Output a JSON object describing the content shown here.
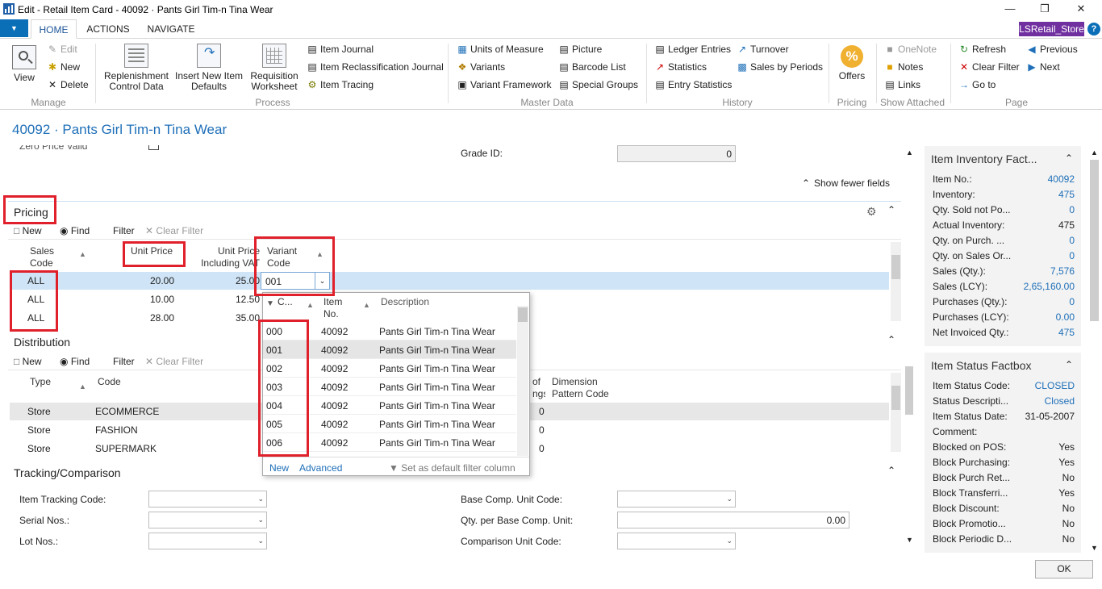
{
  "window": {
    "title": "Edit - Retail Item Card - 40092 · Pants Girl Tim-n Tina Wear"
  },
  "ribbon": {
    "tabs": [
      "HOME",
      "ACTIONS",
      "NAVIGATE"
    ],
    "company": "LSRetail_Store",
    "manage": {
      "view": "View",
      "edit": "Edit",
      "new": "New",
      "delete": "Delete",
      "group": "Manage"
    },
    "process": {
      "replenishment": "Replenishment Control Data",
      "insert_defaults": "Insert New Item Defaults",
      "requisition": "Requisition Worksheet",
      "item_journal": "Item Journal",
      "item_reclass": "Item Reclassification Journal",
      "item_tracing": "Item Tracing",
      "group": "Process"
    },
    "master": {
      "uom": "Units of Measure",
      "variants": "Variants",
      "variant_framework": "Variant Framework",
      "picture": "Picture",
      "barcode": "Barcode List",
      "special_groups": "Special Groups",
      "group": "Master Data"
    },
    "history": {
      "ledger": "Ledger Entries",
      "statistics": "Statistics",
      "entry_stats": "Entry Statistics",
      "turnover": "Turnover",
      "sales_periods": "Sales by Periods",
      "group": "History"
    },
    "pricing": {
      "offers": "Offers",
      "group": "Pricing"
    },
    "show_attached": {
      "onenote": "OneNote",
      "notes": "Notes",
      "links": "Links",
      "group": "Show Attached"
    },
    "page": {
      "refresh": "Refresh",
      "clear_filter": "Clear Filter",
      "goto": "Go to",
      "previous": "Previous",
      "next": "Next",
      "group": "Page"
    }
  },
  "page_title": "40092 · Pants Girl Tim-n Tina Wear",
  "top_fields": {
    "zero_price_label": "Zero Price Valid",
    "grade_label": "Grade ID:",
    "grade_value": "0",
    "show_fewer": "Show fewer fields"
  },
  "pricing": {
    "title": "Pricing",
    "toolbar": {
      "new": "New",
      "find": "Find",
      "filter": "Filter",
      "clear_filter": "Clear Filter"
    },
    "columns": {
      "sales_code": "Sales Code",
      "unit_price": "Unit Price",
      "unit_price_vat": "Unit Price Including VAT",
      "variant_code": "Variant Code"
    },
    "rows": [
      {
        "code": "ALL",
        "price": "20.00",
        "vat": "25.00",
        "variant": "001"
      },
      {
        "code": "ALL",
        "price": "10.00",
        "vat": "12.50",
        "variant": ""
      },
      {
        "code": "ALL",
        "price": "28.00",
        "vat": "35.00",
        "variant": ""
      }
    ]
  },
  "lookup": {
    "columns": {
      "code": "C...",
      "item_no": "Item No.",
      "description": "Description"
    },
    "rows": [
      {
        "code": "000",
        "item": "40092",
        "desc": "Pants Girl Tim-n Tina Wear"
      },
      {
        "code": "001",
        "item": "40092",
        "desc": "Pants Girl Tim-n Tina Wear"
      },
      {
        "code": "002",
        "item": "40092",
        "desc": "Pants Girl Tim-n Tina Wear"
      },
      {
        "code": "003",
        "item": "40092",
        "desc": "Pants Girl Tim-n Tina Wear"
      },
      {
        "code": "004",
        "item": "40092",
        "desc": "Pants Girl Tim-n Tina Wear"
      },
      {
        "code": "005",
        "item": "40092",
        "desc": "Pants Girl Tim-n Tina Wear"
      },
      {
        "code": "006",
        "item": "40092",
        "desc": "Pants Girl Tim-n Tina Wear"
      }
    ],
    "footer": {
      "new": "New",
      "advanced": "Advanced",
      "set_default": "Set as default filter column"
    }
  },
  "distribution": {
    "title": "Distribution",
    "toolbar": {
      "new": "New",
      "find": "Find",
      "filter": "Filter",
      "clear_filter": "Clear Filter"
    },
    "columns": {
      "type": "Type",
      "code": "Code",
      "of_ngs": "of ngs",
      "dimension": "Dimension Pattern Code"
    },
    "rows": [
      {
        "type": "Store",
        "code": "ECOMMERCE",
        "num": "0"
      },
      {
        "type": "Store",
        "code": "FASHION",
        "num": "0"
      },
      {
        "type": "Store",
        "code": "SUPERMARK",
        "num": "0"
      }
    ]
  },
  "tracking": {
    "title": "Tracking/Comparison",
    "item_tracking": "Item Tracking Code:",
    "serial": "Serial Nos.:",
    "lot": "Lot Nos.:",
    "base_comp": "Base Comp. Unit Code:",
    "qty_base": "Qty. per Base Comp. Unit:",
    "qty_base_value": "0.00",
    "comparison": "Comparison Unit Code:"
  },
  "inventory_factbox": {
    "title": "Item Inventory Fact...",
    "rows": [
      {
        "k": "Item No.:",
        "v": "40092",
        "link": true
      },
      {
        "k": "Inventory:",
        "v": "475",
        "link": true
      },
      {
        "k": "Qty. Sold not Po...",
        "v": "0",
        "link": true
      },
      {
        "k": "Actual Inventory:",
        "v": "475",
        "link": false
      },
      {
        "k": "Qty. on Purch. ...",
        "v": "0",
        "link": true
      },
      {
        "k": "Qty. on Sales Or...",
        "v": "0",
        "link": true
      },
      {
        "k": "Sales (Qty.):",
        "v": "7,576",
        "link": true
      },
      {
        "k": "Sales (LCY):",
        "v": "2,65,160.00",
        "link": true
      },
      {
        "k": "Purchases (Qty.):",
        "v": "0",
        "link": true
      },
      {
        "k": "Purchases (LCY):",
        "v": "0.00",
        "link": true
      },
      {
        "k": "Net Invoiced Qty.:",
        "v": "475",
        "link": true
      }
    ]
  },
  "status_factbox": {
    "title": "Item Status Factbox",
    "rows": [
      {
        "k": "Item Status Code:",
        "v": "CLOSED",
        "link": true
      },
      {
        "k": "Status Descripti...",
        "v": "Closed",
        "link": true
      },
      {
        "k": "Item Status Date:",
        "v": "31-05-2007",
        "link": false
      },
      {
        "k": "Comment:",
        "v": "",
        "link": false
      },
      {
        "k": "Blocked on POS:",
        "v": "Yes",
        "link": false
      },
      {
        "k": "Block Purchasing:",
        "v": "Yes",
        "link": false
      },
      {
        "k": "Block Purch Ret...",
        "v": "No",
        "link": false
      },
      {
        "k": "Block Transferri...",
        "v": "Yes",
        "link": false
      },
      {
        "k": "Block Discount:",
        "v": "No",
        "link": false
      },
      {
        "k": "Block Promotio...",
        "v": "No",
        "link": false
      },
      {
        "k": "Block Periodic D...",
        "v": "No",
        "link": false
      }
    ]
  },
  "ok": "OK",
  "colors": {
    "accent": "#1e6fb8",
    "highlight": "#e0202b",
    "selected": "#cfe4f6",
    "company": "#7030a0"
  }
}
